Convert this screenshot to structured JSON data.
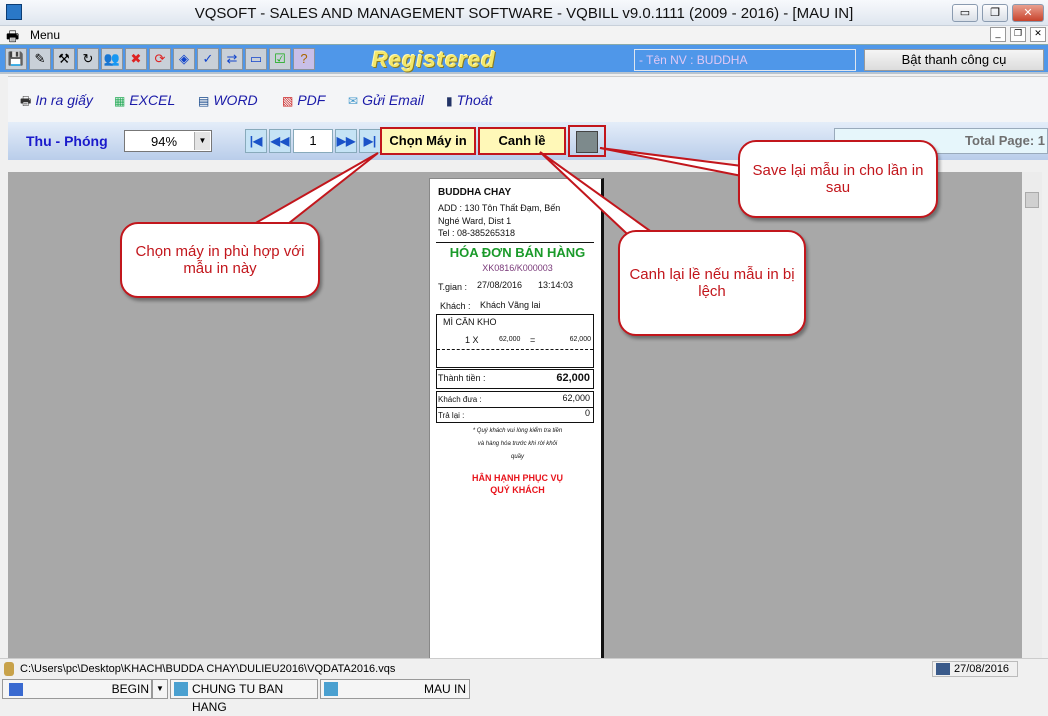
{
  "window": {
    "title": "VQSOFT - SALES AND MANAGEMENT SOFTWARE - VQBILL v9.0.1111 (2009 - 2016) - [MAU IN]",
    "minimize": "▭",
    "restore": "❐",
    "close": "✕"
  },
  "menu": {
    "label": "Menu"
  },
  "toolbar": {
    "icons": [
      "save-icon",
      "user-edit-icon",
      "tools-icon",
      "refresh-icon",
      "users-icon",
      "close-icon",
      "sync-icon",
      "info-icon",
      "spellcheck-icon",
      "teamviewer-icon",
      "window-icon",
      "check-icon",
      "help-icon"
    ],
    "registered": "Registered",
    "employee": "- Tên NV : BUDDHA",
    "toggle_toolbar": "Bật thanh công cụ"
  },
  "export": {
    "print": "In ra giấy",
    "excel": "EXCEL",
    "word": "WORD",
    "pdf": "PDF",
    "email": "Gửi Email",
    "exit": "Thoát"
  },
  "nav": {
    "zoom_label": "Thu - Phóng",
    "zoom_value": "94%",
    "page": "1",
    "choose_printer": "Chọn Máy in",
    "margins": "Canh lề",
    "total_page": "Total Page: 1"
  },
  "receipt": {
    "store": "BUDDHA CHAY",
    "address1": "ADD : 130 Tôn Thất Đạm, Bến",
    "address2": "Nghé Ward, Dist 1",
    "tel": "Tel : 08-385265318",
    "title": "HÓA ĐƠN BÁN HÀNG",
    "code": "XK0816/K000003",
    "time_label": "T.gian :",
    "date": "27/08/2016",
    "time": "13:14:03",
    "customer_label": "Khách :",
    "customer": "Khách Vãng lai",
    "item": "MÌ CĂN KHO",
    "qty": "1 X",
    "price": "62,000",
    "eq": "=",
    "amount": "62,000",
    "total_label": "Thành tiền :",
    "total": "62,000",
    "paid_label": "Khách đưa :",
    "paid": "62,000",
    "change_label": "Trả lại :",
    "change": "0",
    "note1": "* Quý khách vui lòng kiểm tra tiền",
    "note2": "và hàng hóa trước khi rời khỏi",
    "note3": "quầy",
    "thanks1": "HÂN HẠNH PHỤC VỤ",
    "thanks2": "QUÝ KHÁCH",
    "title_color": "#1a9a2a",
    "thanks_color": "#e8141c"
  },
  "callouts": {
    "printer": "Chọn máy in phù hợp với mẫu in này",
    "margin": "Canh lại lề nếu mẫu in bị lệch",
    "save": "Save lại mẫu in cho lần in sau",
    "color": "#c2161c"
  },
  "status": {
    "path": "C:\\Users\\pc\\Desktop\\KHACH\\BUDDA CHAY\\DULIEU2016\\VQDATA2016.vqs",
    "date": "27/08/2016"
  },
  "taskbar": {
    "begin": "BEGIN",
    "tab1": "CHUNG TU BAN HANG",
    "tab2": "MAU IN"
  }
}
